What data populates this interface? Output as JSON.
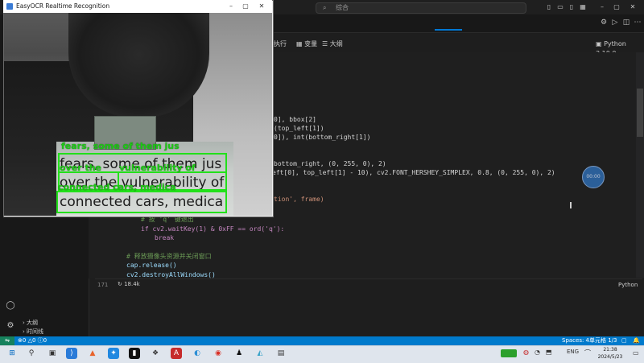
{
  "vscode": {
    "command_center_text": "综合",
    "toolbar": {
      "outline_label": "大纲",
      "variables_label": "变量",
      "run_label": "执行",
      "kernel_label": "Python 3.10.0"
    },
    "sidebar": {
      "items": [
        {
          "label": "大纲"
        },
        {
          "label": "时间线"
        }
      ]
    },
    "editor": {
      "line_prefix_fragments": [
        "0], bbox[2]",
        "(top_left[1])",
        "0]), int(bottom_right[1])",
        "bottom_right, (0, 255, 0), 2)",
        "eft[0], top_left[1] - 10), cv2.FONT_HERSHEY_SIMPLEX, 0.8, (0, 255, 0), 2)",
        "tion', frame)"
      ],
      "comment_quit": "# 按 'q' 键退出",
      "if_line": "if cv2.waitKey(1) & 0xFF == ord('q'):",
      "break_line": "break",
      "comment_release": "# 释放摄像头资源并关闭窗口",
      "release_line": "cap.release()",
      "destroy_line": "cv2.destroyAllWindows()",
      "floating_badge": "00:00"
    },
    "cell_status": {
      "line_number": "171",
      "memory": "18.4k",
      "language": "Python"
    },
    "status_bar": {
      "errors": "0",
      "warnings": "0",
      "info": "0",
      "spaces": "Spaces: 4",
      "cell": "单元格 1/3"
    }
  },
  "ocr_window": {
    "title": "EasyOCR Realtime Recognition",
    "book_lines": [
      "fears, some of them jus",
      "over the vulnerability of",
      "connected cars, medica"
    ],
    "detections": [
      {
        "label": "fears, some of them jus"
      },
      {
        "label": "over the"
      },
      {
        "label": "vulnerability of"
      },
      {
        "label": "connected cars, medica"
      }
    ]
  },
  "taskbar": {
    "clock_time": "21:38",
    "clock_date": "2024/5/23",
    "tray_text": "ENG"
  },
  "colors": {
    "detection_green": "#22e01a",
    "status_bar_blue": "#007acc",
    "editor_bg": "#1f1f1f"
  }
}
